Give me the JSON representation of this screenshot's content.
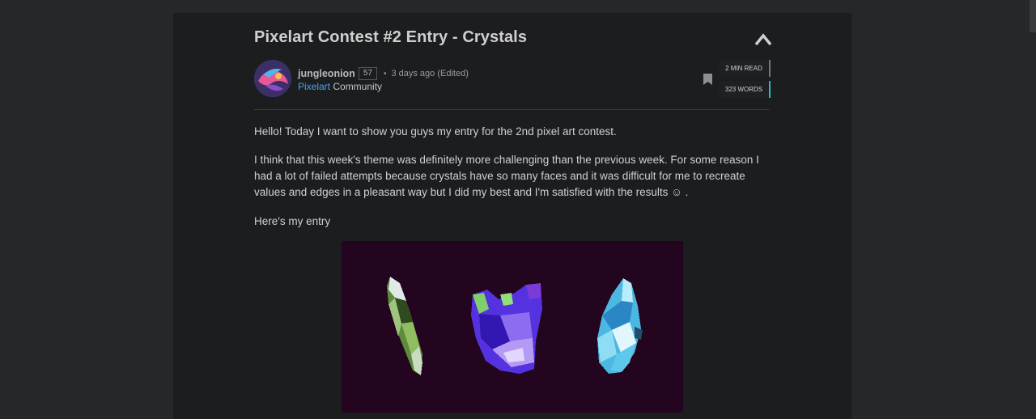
{
  "post": {
    "title": "Pixelart Contest #2 Entry - Crystals",
    "author": {
      "name": "jungleonion",
      "reputation": "57",
      "time": "3 days ago (Edited)"
    },
    "community": {
      "name": "Pixelart",
      "suffix": " Community"
    },
    "stats": {
      "read_time": "2 MIN READ",
      "words": "323 WORDS"
    },
    "paragraphs": [
      "Hello! Today I want to show you guys my entry for the 2nd pixel art contest.",
      "I think that this week's theme was definitely more challenging than the previous week. For some reason I had a lot of failed attempts because crystals have so many faces and it was difficult for me to recreate values and edges in a pleasant way but I did my best and I'm satisfied with the results ☺ .",
      "Here's my entry"
    ]
  },
  "icons": {
    "collapse": "chevron-up-icon",
    "bookmark": "bookmark-icon"
  },
  "colors": {
    "background": "#26272a",
    "card": "#1c1d1f",
    "link": "#4aa3e8",
    "words_accent": "#2ab6d4",
    "art_background": "#24051f"
  }
}
